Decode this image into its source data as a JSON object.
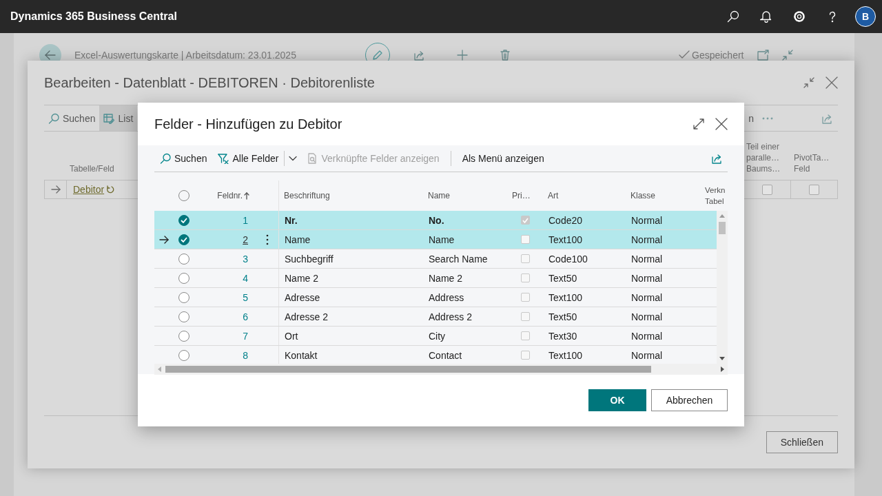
{
  "app_bar": {
    "title": "Dynamics 365 Business Central",
    "avatar": "B"
  },
  "page": {
    "caption": "Excel-Auswertungskarte | Arbeitsdatum: 23.01.2025",
    "status": "Gespeichert"
  },
  "sheet_dialog": {
    "title": "Bearbeiten - Datenblatt - DEBITOREN · Debitorenliste",
    "toolbar": [
      {
        "label": "Suchen",
        "kind": "search",
        "selected": false
      },
      {
        "label": "List",
        "kind": "list",
        "selected": true
      }
    ],
    "toolbar_right": "n",
    "columns": [
      "Tabelle/Feld",
      "Teil einer paralle… Baums…",
      "PivotTa… Feld"
    ],
    "row": {
      "label": "Debitor",
      "current": true,
      "checks": [
        false,
        false
      ]
    },
    "close_button": "Schließen"
  },
  "fields_dialog": {
    "title": "Felder - Hinzufügen zu Debitor",
    "toolbar": [
      {
        "label": "Suchen",
        "kind": "search",
        "disabled": false
      },
      {
        "label": "Alle Felder",
        "kind": "filter",
        "disabled": false
      },
      {
        "label": "Verknüpfte Felder anzeigen",
        "kind": "related",
        "disabled": true
      },
      {
        "label": "Als Menü anzeigen",
        "kind": "plain",
        "disabled": false
      }
    ],
    "columns": [
      "Feldnr.",
      "Beschriftung",
      "Name",
      "Pri…",
      "Art",
      "Klasse",
      "Verkn Tabel"
    ],
    "rows": [
      {
        "number": "1",
        "caption": "Nr.",
        "name": "No.",
        "primary_key": true,
        "type": "Code20",
        "class": "Normal",
        "selected": true,
        "current": false
      },
      {
        "number": "2",
        "caption": "Name",
        "name": "Name",
        "primary_key": false,
        "type": "Text100",
        "class": "Normal",
        "selected": true,
        "current": true
      },
      {
        "number": "3",
        "caption": "Suchbegriff",
        "name": "Search Name",
        "primary_key": false,
        "type": "Code100",
        "class": "Normal",
        "selected": false,
        "current": false
      },
      {
        "number": "4",
        "caption": "Name 2",
        "name": "Name 2",
        "primary_key": false,
        "type": "Text50",
        "class": "Normal",
        "selected": false,
        "current": false
      },
      {
        "number": "5",
        "caption": "Adresse",
        "name": "Address",
        "primary_key": false,
        "type": "Text100",
        "class": "Normal",
        "selected": false,
        "current": false
      },
      {
        "number": "6",
        "caption": "Adresse 2",
        "name": "Address 2",
        "primary_key": false,
        "type": "Text50",
        "class": "Normal",
        "selected": false,
        "current": false
      },
      {
        "number": "7",
        "caption": "Ort",
        "name": "City",
        "primary_key": false,
        "type": "Text30",
        "class": "Normal",
        "selected": false,
        "current": false
      },
      {
        "number": "8",
        "caption": "Kontakt",
        "name": "Contact",
        "primary_key": false,
        "type": "Text100",
        "class": "Normal",
        "selected": false,
        "current": false
      }
    ],
    "buttons": [
      {
        "label": "OK",
        "kind": "primary"
      },
      {
        "label": "Abbrechen",
        "kind": "secondary"
      }
    ]
  }
}
